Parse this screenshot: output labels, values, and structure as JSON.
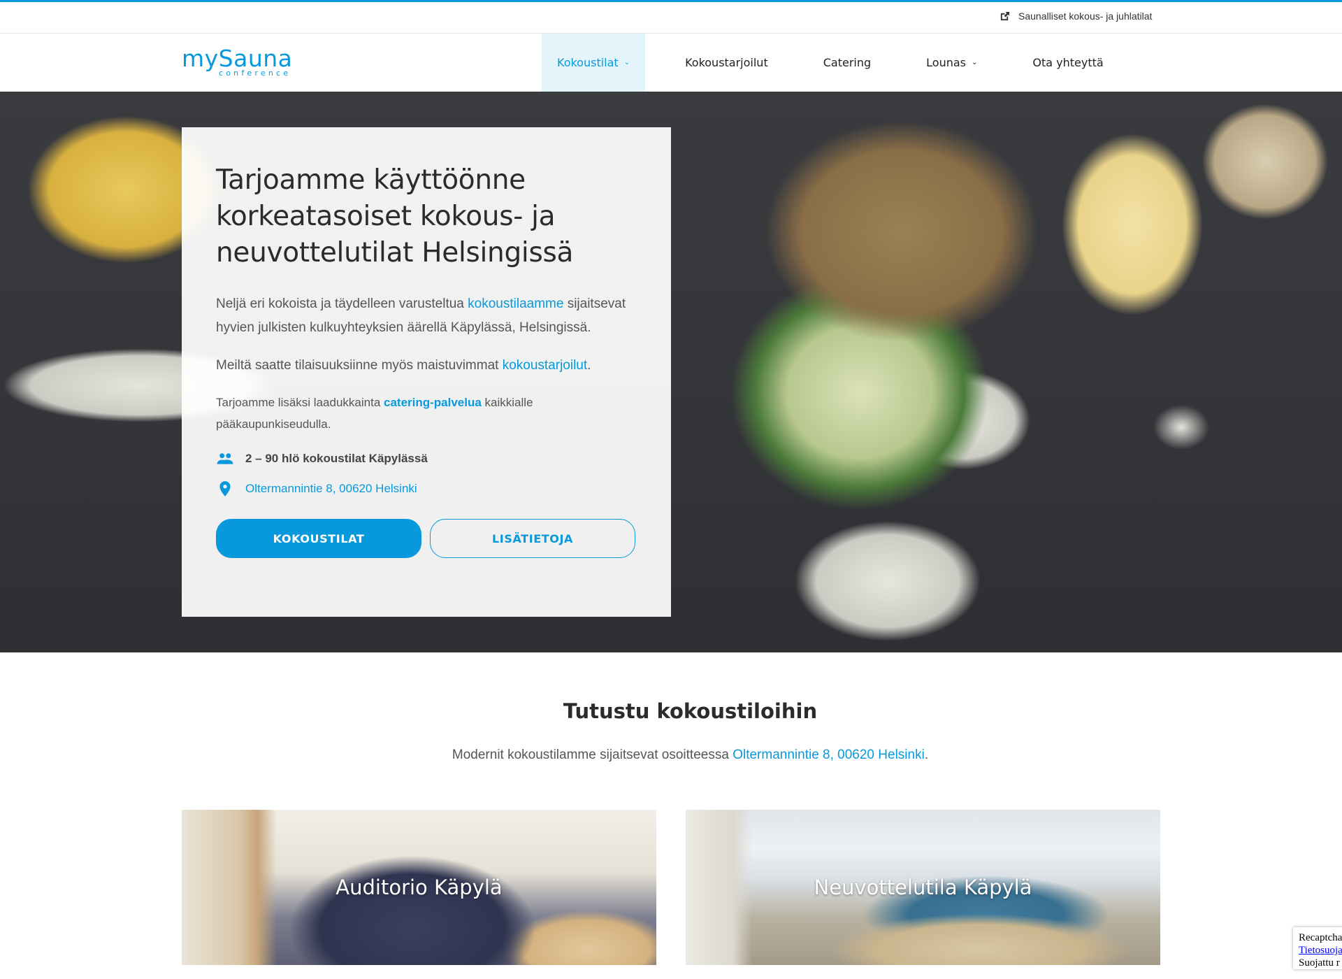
{
  "topbar": {
    "link_label": "Saunalliset kokous- ja juhlatilat",
    "link_icon": "external-link-icon"
  },
  "header": {
    "logo_main": "mySauna",
    "logo_sub": "conference",
    "nav": [
      {
        "label": "Kokoustilat",
        "has_dropdown": true,
        "active": true
      },
      {
        "label": "Kokoustarjoilut",
        "has_dropdown": false,
        "active": false
      },
      {
        "label": "Catering",
        "has_dropdown": false,
        "active": false
      },
      {
        "label": "Lounas",
        "has_dropdown": true,
        "active": false
      },
      {
        "label": "Ota yhteyttä",
        "has_dropdown": false,
        "active": false
      }
    ],
    "chevron": "⌄"
  },
  "hero": {
    "title": "Tarjoamme käyttöönne korkeatasoiset kokous- ja neuvottelutilat Helsingissä",
    "p1_before": "Neljä eri kokoista ja täydelleen varusteltua ",
    "p1_link": "kokoustilaamme",
    "p1_after": " sijaitsevat hyvien julkisten kulkuyhteyksien äärellä Käpylässä, Helsingissä.",
    "p2_before": "Meiltä saatte tilaisuuksiinne myös maistuvimmat ",
    "p2_link": "kokoustarjoilut",
    "p2_after": ".",
    "p3_before": "Tarjoamme lisäksi laadukkainta ",
    "p3_link": "catering-palvelua",
    "p3_after": " kaikkialle pääkaupunkiseudulla.",
    "capacity": "2 – 90 hlö kokoustilat Käpylässä",
    "capacity_icon": "people-icon",
    "address": "Oltermannintie 8, 00620 Helsinki",
    "address_icon": "map-pin-icon",
    "btn_primary": "KOKOUSTILAT",
    "btn_secondary": "LISÄTIETOJA"
  },
  "rooms_section": {
    "title": "Tutustu kokoustiloihin",
    "subtitle_before": "Modernit kokoustilamme sijaitsevat osoitteessa ",
    "subtitle_link": "Oltermannintie 8, 00620 Helsinki",
    "subtitle_after": ".",
    "rooms": [
      {
        "label": "Auditorio Käpylä"
      },
      {
        "label": "Neuvottelutila Käpylä"
      }
    ]
  },
  "recaptcha": {
    "line1": "Recaptcha",
    "line2_link": "Tietosuoja",
    "line3": "Suojattu r"
  },
  "colors": {
    "accent": "#0899dc",
    "active_nav_bg": "#e3f4fb",
    "text": "#333333"
  }
}
